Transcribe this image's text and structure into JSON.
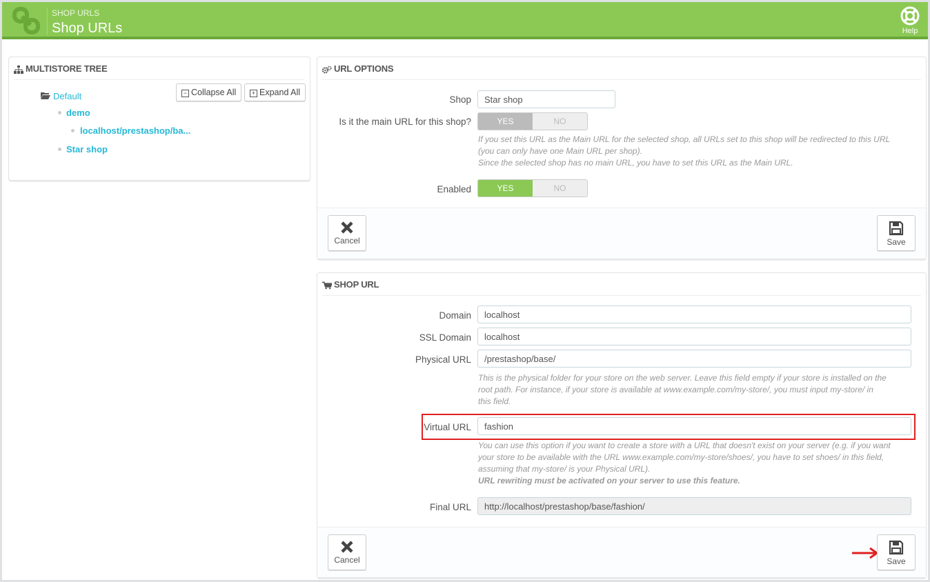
{
  "header": {
    "breadcrumb": "SHOP URLS",
    "title": "Shop URLs",
    "help_label": "Help"
  },
  "tree": {
    "title": "MULTISTORE TREE",
    "collapse_label": "Collapse All",
    "expand_label": "Expand All",
    "group": "Default",
    "shop1": "demo",
    "shop1_url": "localhost/prestashop/ba...",
    "shop2": "Star shop"
  },
  "url_options": {
    "title": "URL OPTIONS",
    "shop_label": "Shop",
    "shop_value": "Star shop",
    "main_url_label": "Is it the main URL for this shop?",
    "yes": "YES",
    "no": "NO",
    "main_help_1": "If you set this URL as the Main URL for the selected shop, all URLs set to this shop will be redirected to this URL",
    "main_help_2": "(you can only have one Main URL per shop).",
    "main_help_3": "Since the selected shop has no main URL, you have to set this URL as the Main URL.",
    "enabled_label": "Enabled",
    "cancel": "Cancel",
    "save": "Save"
  },
  "shop_url": {
    "title": "SHOP URL",
    "domain_label": "Domain",
    "domain_value": "localhost",
    "ssl_label": "SSL Domain",
    "ssl_value": "localhost",
    "physical_label": "Physical URL",
    "physical_value": "/prestashop/base/",
    "physical_help_1": "This is the physical folder for your store on the web server. Leave this field empty if your store is installed on the",
    "physical_help_2": "root path. For instance, if your store is available at www.example.com/my-store/, you must input my-store/ in",
    "physical_help_3": "this field.",
    "virtual_label": "Virtual URL",
    "virtual_value": "fashion",
    "virtual_help_1": "You can use this option if you want to create a store with a URL that doesn't exist on your server (e.g. if you want",
    "virtual_help_2": "your store to be available with the URL www.example.com/my-store/shoes/, you have to set shoes/ in this field,",
    "virtual_help_3": "assuming that my-store/ is your Physical URL).",
    "virtual_help_bold": "URL rewriting must be activated on your server to use this feature.",
    "final_label": "Final URL",
    "final_value": "http://localhost/prestashop/base/fashion/",
    "cancel": "Cancel",
    "save": "Save"
  },
  "colors": {
    "header": "#8bc954",
    "link": "#25b9d7",
    "highlight": "#e02020"
  }
}
